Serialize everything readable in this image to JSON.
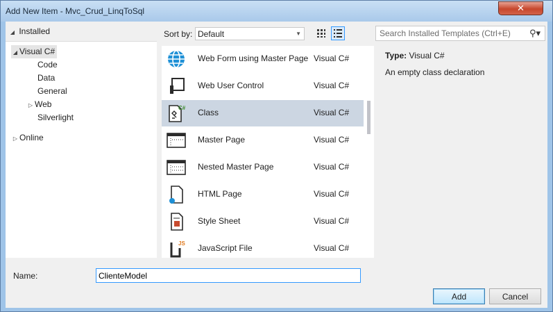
{
  "window": {
    "title": "Add New Item - Mvc_Crud_LinqToSql",
    "close_glyph": "✕"
  },
  "tree": {
    "installed": "Installed",
    "items": [
      {
        "label": "Visual C#"
      },
      {
        "label": "Code"
      },
      {
        "label": "Data"
      },
      {
        "label": "General"
      },
      {
        "label": "Web"
      },
      {
        "label": "Silverlight"
      },
      {
        "label": "Online"
      }
    ]
  },
  "sort": {
    "label": "Sort by:",
    "value": "Default"
  },
  "search": {
    "placeholder": "Search Installed Templates (Ctrl+E)"
  },
  "templates": [
    {
      "name": "Web Form using Master Page",
      "type": "Visual C#",
      "icon": "globe-icon"
    },
    {
      "name": "Web User Control",
      "type": "Visual C#",
      "icon": "user-control-icon"
    },
    {
      "name": "Class",
      "type": "Visual C#",
      "icon": "class-icon",
      "badge": "C#"
    },
    {
      "name": "Master Page",
      "type": "Visual C#",
      "icon": "master-page-icon"
    },
    {
      "name": "Nested Master Page",
      "type": "Visual C#",
      "icon": "nested-master-page-icon"
    },
    {
      "name": "HTML Page",
      "type": "Visual C#",
      "icon": "html-page-icon"
    },
    {
      "name": "Style Sheet",
      "type": "Visual C#",
      "icon": "style-sheet-icon"
    },
    {
      "name": "JavaScript File",
      "type": "Visual C#",
      "icon": "javascript-file-icon",
      "badge": "JS"
    }
  ],
  "details": {
    "type_label": "Type:",
    "type_value": "Visual C#",
    "description": "An empty class declaration"
  },
  "form": {
    "name_label": "Name:",
    "name_value": "ClienteModel"
  },
  "buttons": {
    "add": "Add",
    "cancel": "Cancel"
  },
  "colors": {
    "selection": "#ccd6e2",
    "accent": "#3399ff",
    "frame": "#9fc4e8"
  }
}
